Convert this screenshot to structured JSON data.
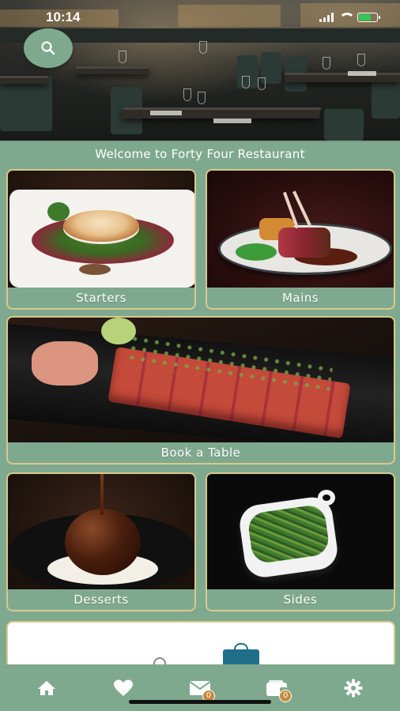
{
  "status": {
    "time": "10:14"
  },
  "header": {
    "welcome": "Welcome to Forty Four Restaurant"
  },
  "tiles": {
    "starters": "Starters",
    "mains": "Mains",
    "book": "Book a Table",
    "desserts": "Desserts",
    "sides": "Sides"
  },
  "tabbar": {
    "items": [
      {
        "icon": "home-icon"
      },
      {
        "icon": "heart-icon"
      },
      {
        "icon": "mail-icon",
        "badge": "0"
      },
      {
        "icon": "wallet-icon",
        "badge": "0"
      },
      {
        "icon": "gear-icon"
      }
    ]
  },
  "colors": {
    "accent": "#7fa98f",
    "border": "#d8c98a",
    "badge": "#c58a3c"
  }
}
